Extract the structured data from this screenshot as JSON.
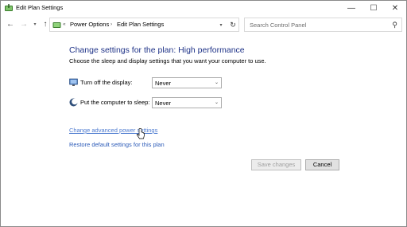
{
  "window": {
    "title": "Edit Plan Settings",
    "controls": {
      "minimize": "—",
      "maximize": "☐",
      "close": "✕"
    }
  },
  "nav": {
    "back": "←",
    "forward": "→",
    "recent": "▾",
    "up": "↑",
    "breadcrumb": {
      "overflow": "«",
      "items": [
        "Power Options",
        "Edit Plan Settings"
      ],
      "separator": "›"
    },
    "dropdown": "▾",
    "refresh": "↻",
    "search_placeholder": "Search Control Panel",
    "search_icon": "⚲"
  },
  "content": {
    "heading": "Change settings for the plan: High performance",
    "subtext": "Choose the sleep and display settings that you want your computer to use.",
    "settings": [
      {
        "label": "Turn off the display:",
        "value": "Never",
        "icon": "monitor-icon"
      },
      {
        "label": "Put the computer to sleep:",
        "value": "Never",
        "icon": "moon-icon"
      }
    ],
    "select_arrow": "⌄",
    "links": {
      "advanced": "Change advanced power settings",
      "restore": "Restore default settings for this plan"
    },
    "buttons": {
      "save": "Save changes",
      "cancel": "Cancel"
    }
  },
  "colors": {
    "heading": "#1e3287",
    "link": "#2c5bb8"
  }
}
